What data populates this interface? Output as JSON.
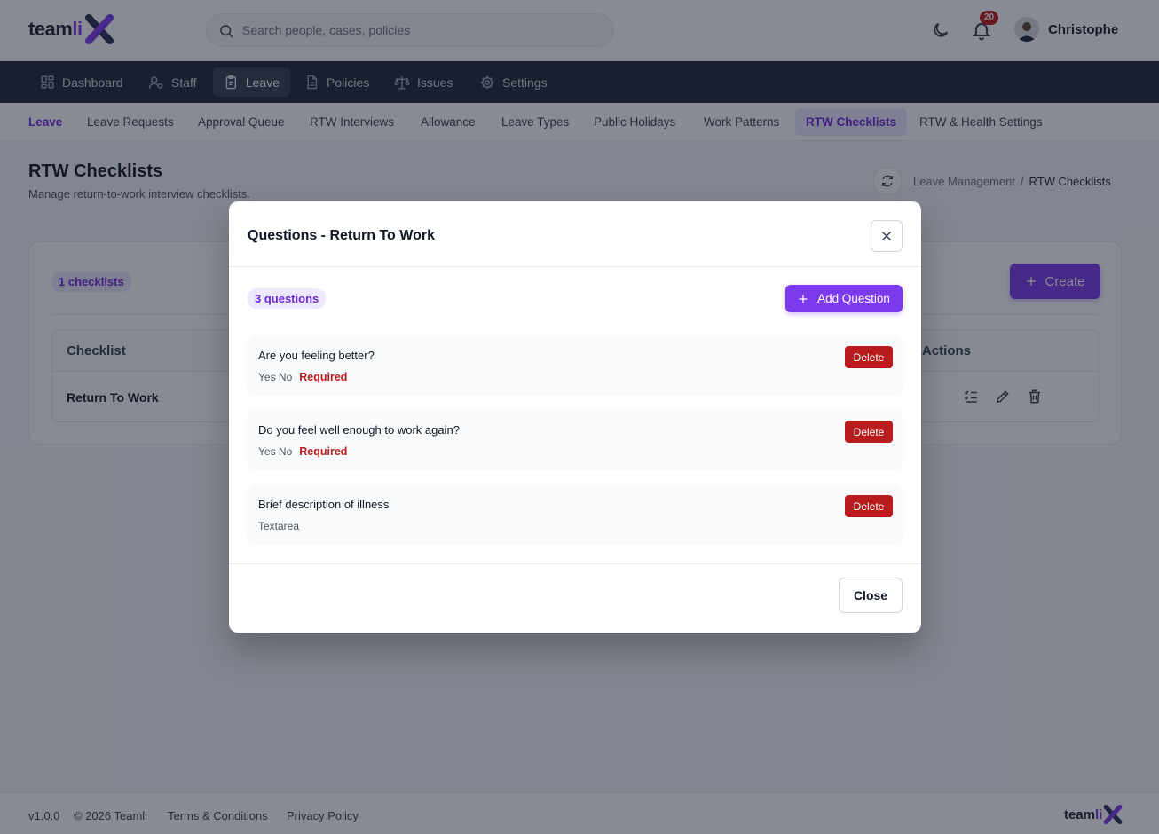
{
  "brand": {
    "logo_prefix": "team",
    "logo_suffix": "li"
  },
  "header": {
    "search_placeholder": "Search people, cases, policies",
    "notifications_count": "20",
    "user_name": "Christophe"
  },
  "main_nav": {
    "items": [
      {
        "label": "Dashboard",
        "icon": "dashboard-icon"
      },
      {
        "label": "Staff",
        "icon": "staff-icon"
      },
      {
        "label": "Leave",
        "icon": "leave-icon",
        "active": true
      },
      {
        "label": "Policies",
        "icon": "policies-icon"
      },
      {
        "label": "Issues",
        "icon": "scales-icon"
      },
      {
        "label": "Settings",
        "icon": "gear-icon"
      }
    ]
  },
  "sub_nav": {
    "items": [
      {
        "label": "Leave"
      },
      {
        "label": "Leave Requests"
      },
      {
        "label": "Approval Queue"
      },
      {
        "label": "RTW Interviews"
      },
      {
        "label": "Allowance"
      },
      {
        "label": "Leave Types"
      },
      {
        "label": "Public Holidays"
      },
      {
        "label": "Work Patterns"
      },
      {
        "label": "RTW Checklists",
        "active": true
      },
      {
        "label": "RTW & Health Settings"
      }
    ]
  },
  "page": {
    "title": "RTW Checklists",
    "subtitle": "Manage return-to-work interview checklists.",
    "breadcrumb": {
      "parent": "Leave Management",
      "separator": "/",
      "current": "RTW Checklists"
    }
  },
  "card": {
    "count_badge": "1 checklists",
    "create_label": "Create",
    "table": {
      "headers": {
        "checklist": "Checklist",
        "actions": "Actions"
      },
      "rows": [
        {
          "name": "Return To Work"
        }
      ]
    }
  },
  "modal": {
    "title": "Questions - Return To Work",
    "count_badge": "3 questions",
    "add_label": "Add Question",
    "questions": [
      {
        "text": "Are you feeling better?",
        "type": "Yes No",
        "required": "Required",
        "delete_label": "Delete"
      },
      {
        "text": "Do you feel well enough to work again?",
        "type": "Yes No",
        "required": "Required",
        "delete_label": "Delete"
      },
      {
        "text": "Brief description of illness",
        "type": "Textarea",
        "required": "",
        "delete_label": "Delete"
      }
    ],
    "close_label": "Close"
  },
  "footer": {
    "version": "v1.0.0",
    "copyright": "© 2026 Teamli",
    "terms": "Terms & Conditions",
    "privacy": "Privacy Policy"
  },
  "colors": {
    "accent": "#7c3aed",
    "nav_bg": "#1f2937",
    "danger": "#b91c1c",
    "badge_bg": "#ede9fe"
  }
}
